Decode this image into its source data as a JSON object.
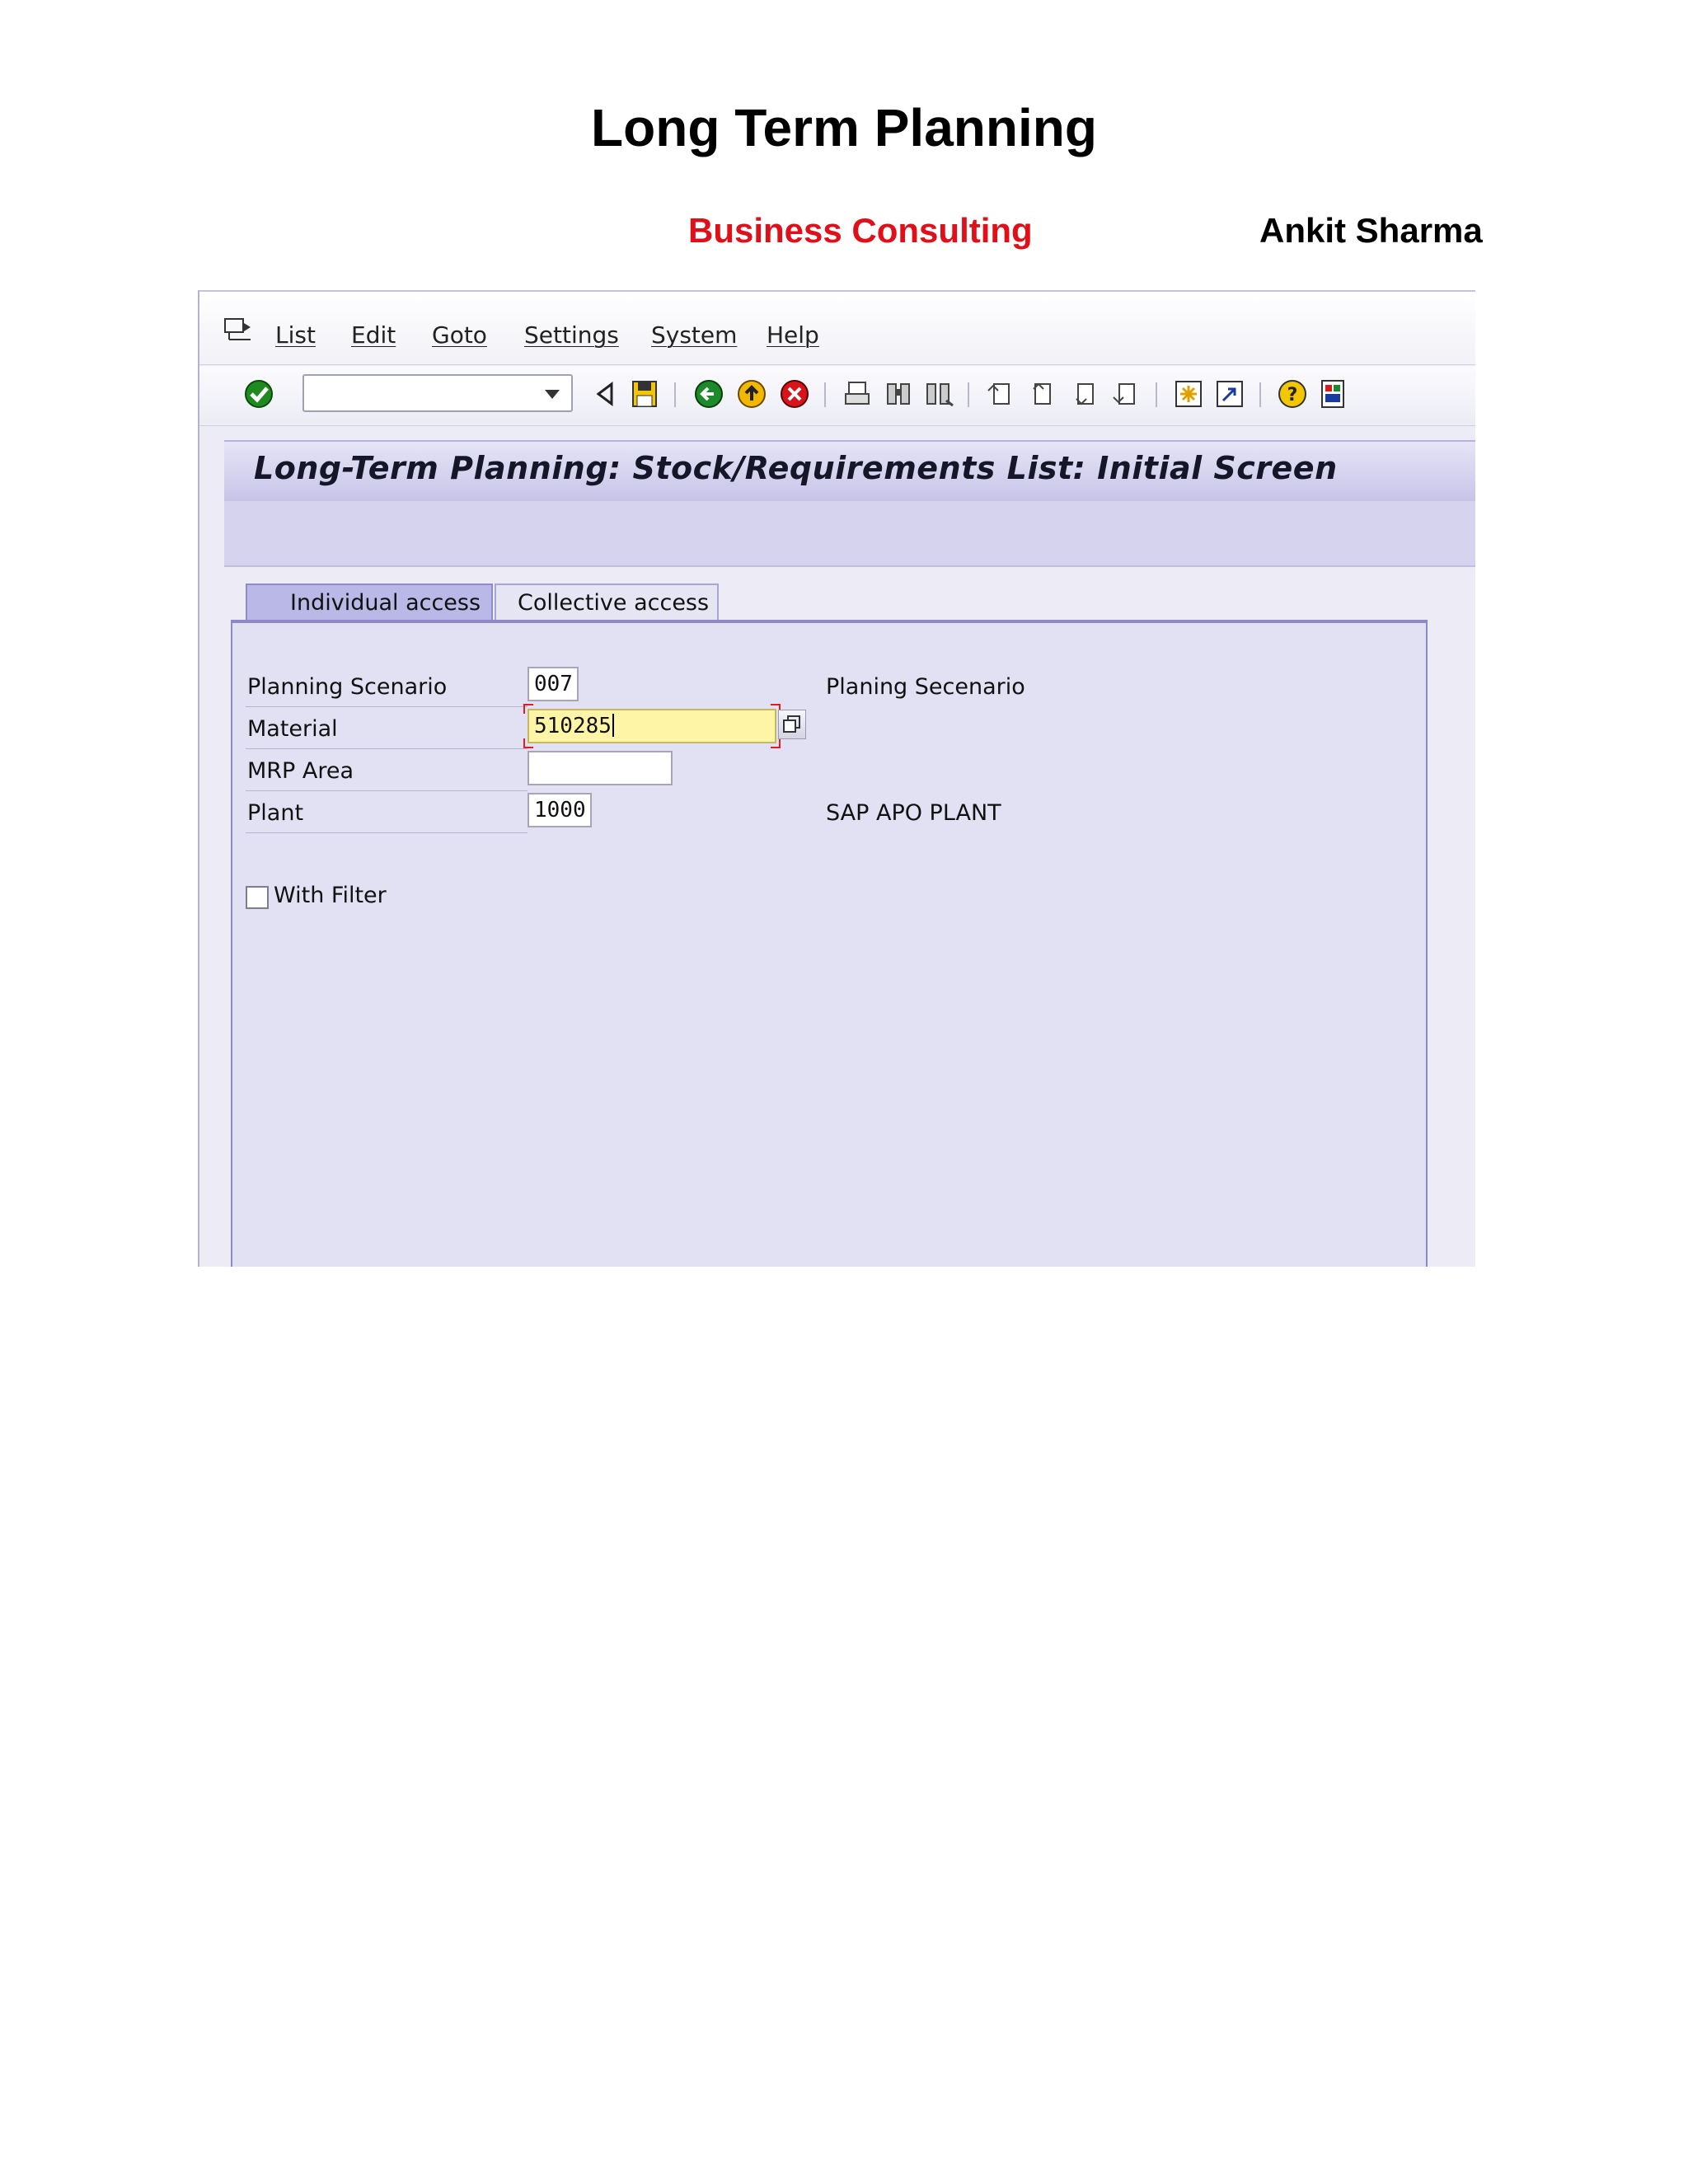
{
  "document": {
    "title": "Long Term Planning",
    "organization": "Business Consulting",
    "author": "Ankit Sharma"
  },
  "menu": {
    "items": [
      "List",
      "Edit",
      "Goto",
      "Settings",
      "System",
      "Help"
    ]
  },
  "toolbar": {
    "command_field_value": ""
  },
  "screen": {
    "title": "Long-Term Planning: Stock/Requirements List: Initial Screen"
  },
  "tabs": [
    {
      "label": "Individual access",
      "active": true
    },
    {
      "label": "Collective access",
      "active": false
    }
  ],
  "form": {
    "planning_scenario": {
      "label": "Planning Scenario",
      "value": "007",
      "description": "Planing Secenario"
    },
    "material": {
      "label": "Material",
      "value": "510285"
    },
    "mrp_area": {
      "label": "MRP Area",
      "value": ""
    },
    "plant": {
      "label": "Plant",
      "value": "1000",
      "description": "SAP APO PLANT"
    },
    "with_filter": {
      "label": "With Filter",
      "checked": false
    }
  },
  "colors": {
    "accent_red": "#e0101a",
    "material_field_bg": "#fff5a6",
    "tab_active": "#b9b8e6",
    "panel_bg": "#e2e1f3"
  }
}
